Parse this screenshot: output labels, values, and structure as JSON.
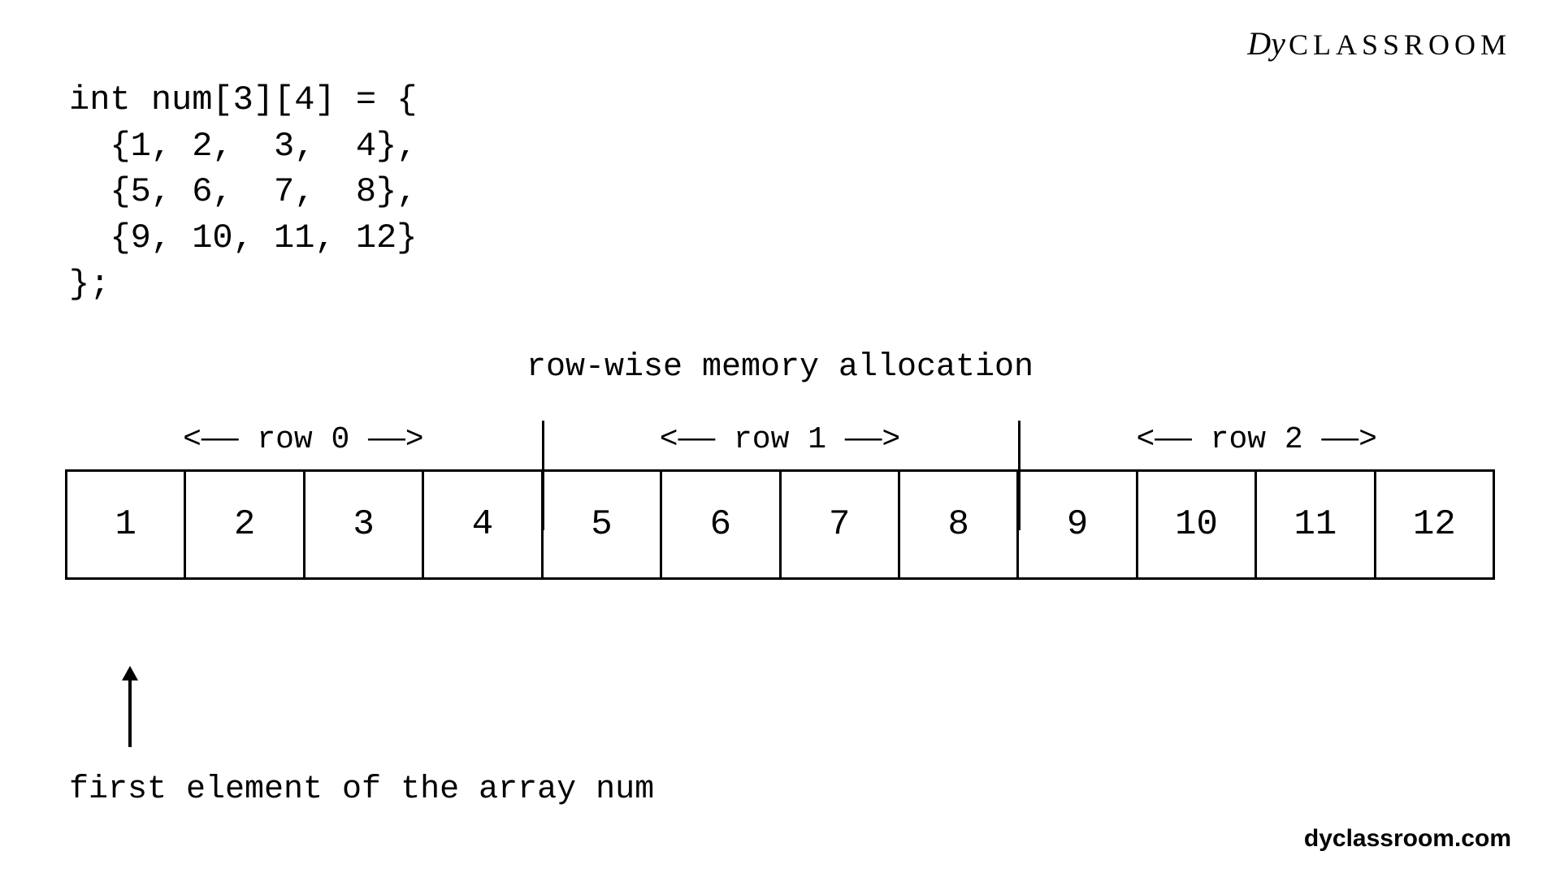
{
  "logo": {
    "prefix": "Dy",
    "text": "CLASSROOM"
  },
  "code": "int num[3][4] = {\n  {1, 2,  3,  4},\n  {5, 6,  7,  8},\n  {9, 10, 11, 12}\n};",
  "title": "row-wise memory allocation",
  "row_labels": [
    "<—— row 0 ——>",
    "<—— row 1 ——>",
    "<—— row 2 ——>"
  ],
  "cells": [
    "1",
    "2",
    "3",
    "4",
    "5",
    "6",
    "7",
    "8",
    "9",
    "10",
    "11",
    "12"
  ],
  "first_element_label": "first element of the array num",
  "footer": "dyclassroom.com"
}
